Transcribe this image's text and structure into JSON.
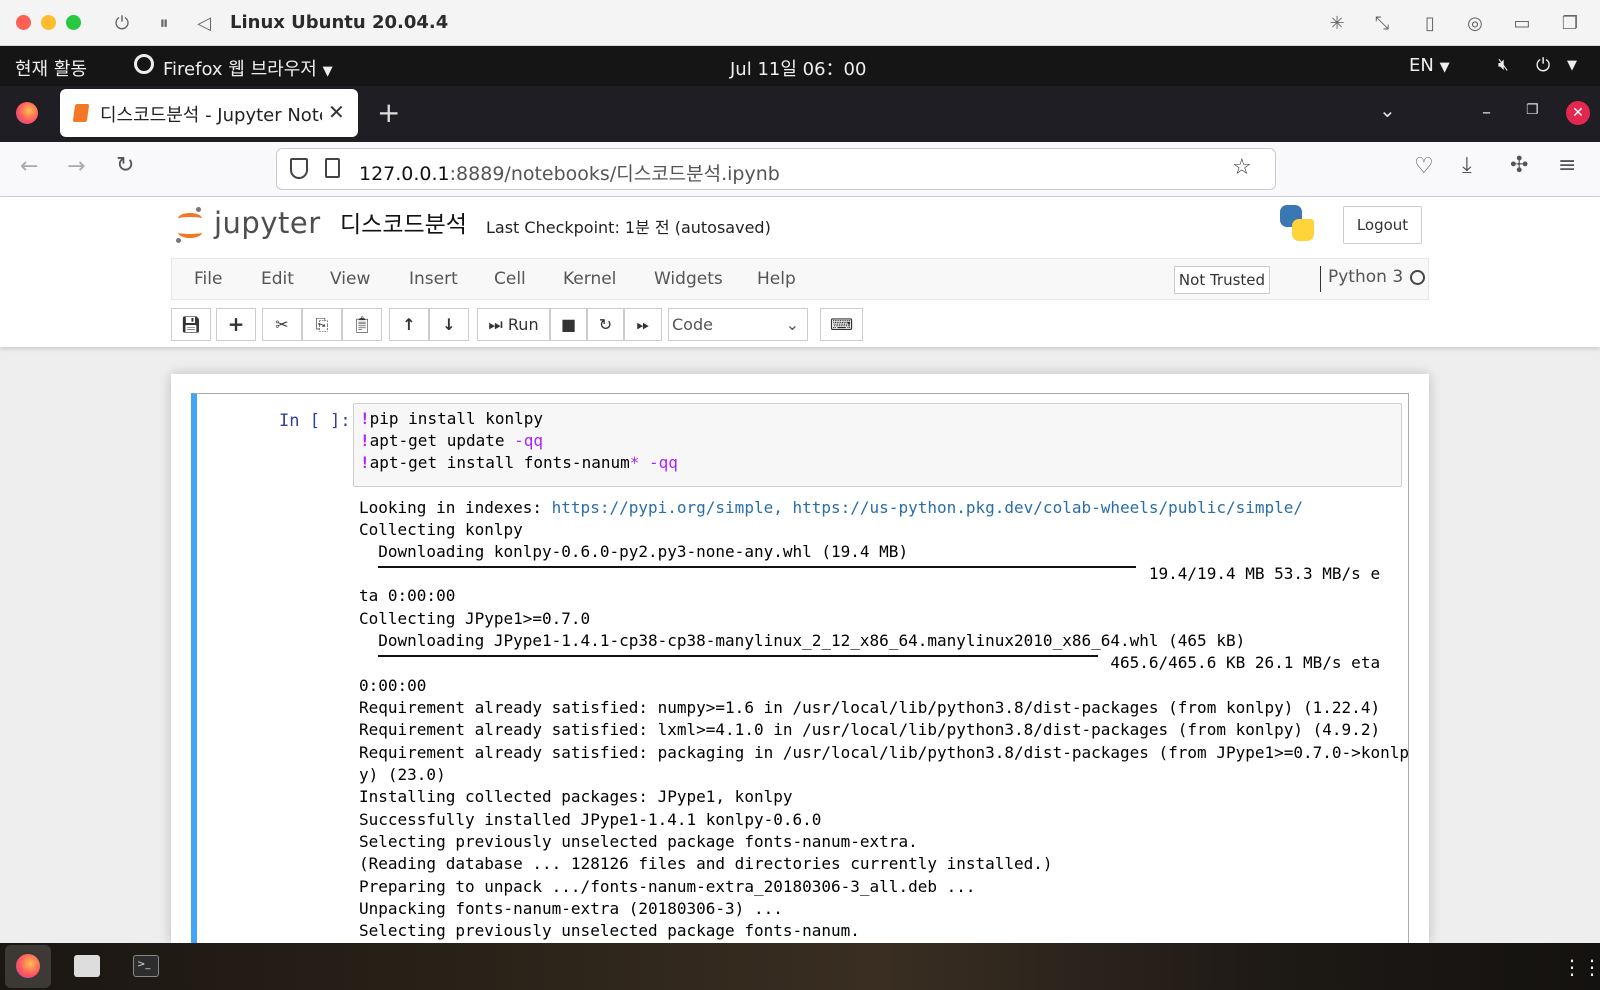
{
  "mac": {
    "title": "Linux Ubuntu 20.04.4"
  },
  "gnome": {
    "activities": "현재 활동",
    "app_menu": "Firefox 웹 브라우저",
    "clock": "Jul 11일  06：00",
    "lang": "EN"
  },
  "browser": {
    "tab_title": "디스코드분석 - Jupyter Notebook",
    "url_host": "127.0.0.1",
    "url_rest": ":8889/notebooks/디스코드분석.ipynb"
  },
  "jupyter": {
    "logo_text": "jupyter",
    "notebook_name": "디스코드분석",
    "checkpoint": "Last Checkpoint: 1분 전   (autosaved)",
    "logout": "Logout",
    "menu": [
      "File",
      "Edit",
      "View",
      "Insert",
      "Cell",
      "Kernel",
      "Widgets",
      "Help"
    ],
    "trust": "Not Trusted",
    "kernel": "Python 3",
    "run_label": "Run",
    "cell_type": "Code"
  },
  "cell": {
    "prompt": "In [ ]:",
    "code": [
      {
        "bang": "!",
        "cmd": "pip install konlpy",
        "flag": ""
      },
      {
        "bang": "!",
        "cmd": "apt-get update ",
        "flag": "-qq"
      },
      {
        "bang": "!",
        "cmd": "apt-get install fonts-nanum",
        "star": "*",
        "flag": " -qq"
      }
    ],
    "output_prefix": "Looking in indexes: ",
    "output_links": "https://pypi.org/simple, https://us-python.pkg.dev/colab-wheels/public/simple/",
    "output": [
      "Collecting konlpy",
      "  Downloading konlpy-0.6.0-py2.py3-none-any.whl (19.4 MB)",
      "                                                                                  19.4/19.4 MB 53.3 MB/s e",
      "ta 0:00:00",
      "Collecting JPype1>=0.7.0",
      "  Downloading JPype1-1.4.1-cp38-cp38-manylinux_2_12_x86_64.manylinux2010_x86_64.whl (465 kB)",
      "                                                                              465.6/465.6 KB 26.1 MB/s eta",
      "0:00:00",
      "Requirement already satisfied: numpy>=1.6 in /usr/local/lib/python3.8/dist-packages (from konlpy) (1.22.4)",
      "Requirement already satisfied: lxml>=4.1.0 in /usr/local/lib/python3.8/dist-packages (from konlpy) (4.9.2)",
      "Requirement already satisfied: packaging in /usr/local/lib/python3.8/dist-packages (from JPype1>=0.7.0->konlp",
      "y) (23.0)",
      "Installing collected packages: JPype1, konlpy",
      "Successfully installed JPype1-1.4.1 konlpy-0.6.0",
      "Selecting previously unselected package fonts-nanum-extra.",
      "(Reading database ... 128126 files and directories currently installed.)",
      "Preparing to unpack .../fonts-nanum-extra_20180306-3_all.deb ...",
      "Unpacking fonts-nanum-extra (20180306-3) ...",
      "Selecting previously unselected package fonts-nanum."
    ]
  },
  "colors": {
    "accent": "#42a5f5",
    "jupyter_orange": "#f37726",
    "ff_close": "#e22850"
  }
}
